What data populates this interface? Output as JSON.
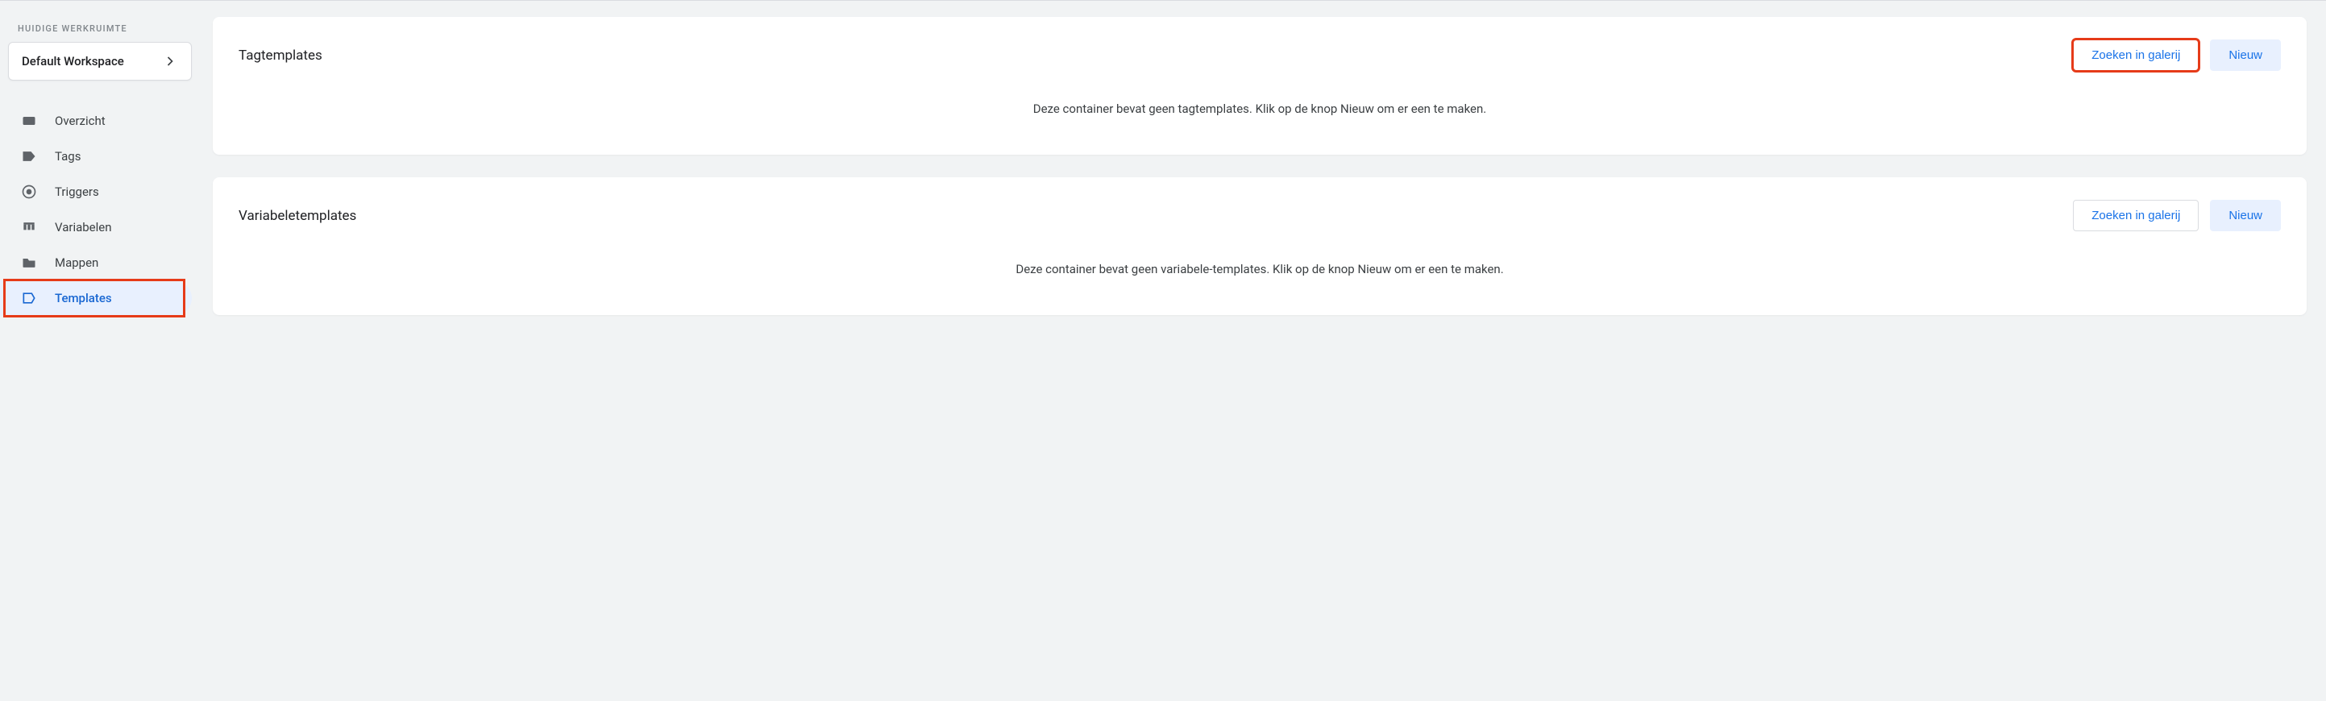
{
  "sidebar": {
    "workspaceLabel": "HUIDIGE WERKRUIMTE",
    "workspaceName": "Default Workspace",
    "items": [
      {
        "label": "Overzicht",
        "icon": "overview-icon",
        "active": false
      },
      {
        "label": "Tags",
        "icon": "tag-icon",
        "active": false
      },
      {
        "label": "Triggers",
        "icon": "trigger-icon",
        "active": false
      },
      {
        "label": "Variabelen",
        "icon": "variable-icon",
        "active": false
      },
      {
        "label": "Mappen",
        "icon": "folder-icon",
        "active": false
      },
      {
        "label": "Templates",
        "icon": "template-icon",
        "active": true
      }
    ]
  },
  "cards": {
    "tagTemplates": {
      "title": "Tagtemplates",
      "searchLabel": "Zoeken in galerij",
      "newLabel": "Nieuw",
      "emptyMessage": "Deze container bevat geen tagtemplates. Klik op de knop Nieuw om er een te maken."
    },
    "variableTemplates": {
      "title": "Variabeletemplates",
      "searchLabel": "Zoeken in galerij",
      "newLabel": "Nieuw",
      "emptyMessage": "Deze container bevat geen variabele-templates. Klik op de knop Nieuw om er een te maken."
    }
  }
}
